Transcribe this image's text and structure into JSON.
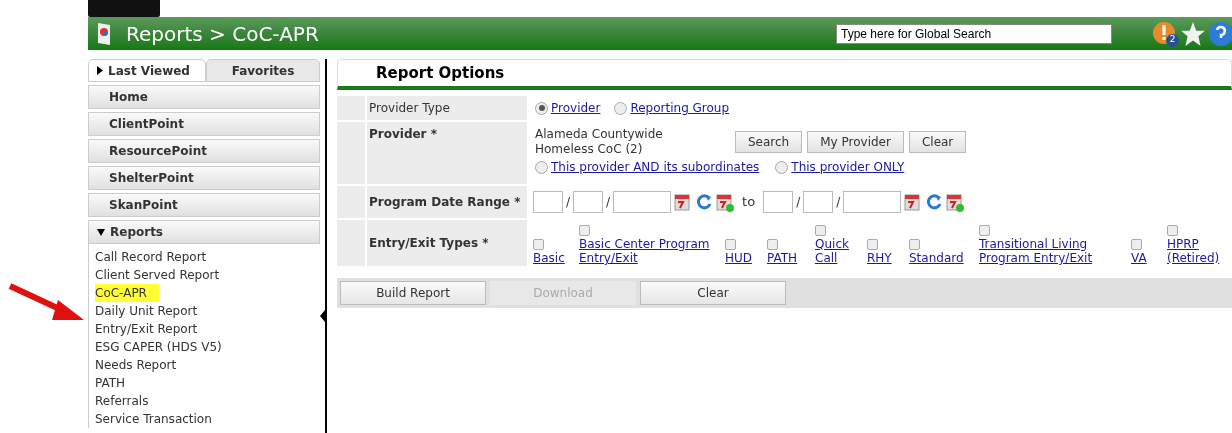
{
  "header": {
    "title": "Reports > CoC-APR",
    "search": {
      "placeholder": "Type here for Global Search"
    },
    "alert_count": "2"
  },
  "sidebar": {
    "tabs": [
      {
        "label": "Last Viewed",
        "selected": true
      },
      {
        "label": "Favorites",
        "selected": false
      }
    ],
    "sections": [
      {
        "label": "Home"
      },
      {
        "label": "ClientPoint"
      },
      {
        "label": "ResourcePoint"
      },
      {
        "label": "ShelterPoint"
      },
      {
        "label": "SkanPoint"
      }
    ],
    "reports": {
      "label": "Reports",
      "expanded": true,
      "items": [
        {
          "label": "Call Record Report",
          "selected": false
        },
        {
          "label": "Client Served Report",
          "selected": false
        },
        {
          "label": "CoC-APR",
          "selected": true
        },
        {
          "label": "Daily Unit Report",
          "selected": false
        },
        {
          "label": "Entry/Exit Report",
          "selected": false
        },
        {
          "label": "ESG CAPER (HDS V5)",
          "selected": false
        },
        {
          "label": "Needs Report",
          "selected": false
        },
        {
          "label": "PATH",
          "selected": false
        },
        {
          "label": "Referrals",
          "selected": false
        },
        {
          "label": "Service Transaction",
          "selected": false
        }
      ]
    }
  },
  "report_options": {
    "title": "Report Options",
    "provider_type": {
      "label": "Provider Type",
      "options": [
        {
          "label": "Provider",
          "selected": true
        },
        {
          "label": "Reporting Group",
          "selected": false
        }
      ]
    },
    "provider": {
      "label": "Provider",
      "required": "*",
      "value": "Alameda Countywide Homeless CoC (2)",
      "buttons": [
        "Search",
        "My Provider",
        "Clear"
      ],
      "scope": [
        {
          "label": "This provider AND its subordinates",
          "selected": false
        },
        {
          "label": "This provider ONLY",
          "selected": false
        }
      ]
    },
    "date_range": {
      "label": "Program Date Range",
      "required": "*",
      "separator": "/",
      "to": "to"
    },
    "entry_exit_types": {
      "label": "Entry/Exit Types",
      "required": "*",
      "items": [
        {
          "label": "Basic",
          "checked": false
        },
        {
          "label": "Basic Center Program Entry/Exit",
          "checked": false
        },
        {
          "label": "HUD",
          "checked": false
        },
        {
          "label": "PATH",
          "checked": false
        },
        {
          "label": "Quick Call",
          "checked": false
        },
        {
          "label": "RHY",
          "checked": false
        },
        {
          "label": "Standard",
          "checked": false
        },
        {
          "label": "Transitional Living Program Entry/Exit",
          "checked": false
        },
        {
          "label": "VA",
          "checked": false
        },
        {
          "label": "HPRP (Retired)",
          "checked": false
        }
      ]
    },
    "actions": [
      {
        "label": "Build Report",
        "disabled": false
      },
      {
        "label": "Download",
        "disabled": true
      },
      {
        "label": "Clear",
        "disabled": false
      }
    ]
  }
}
